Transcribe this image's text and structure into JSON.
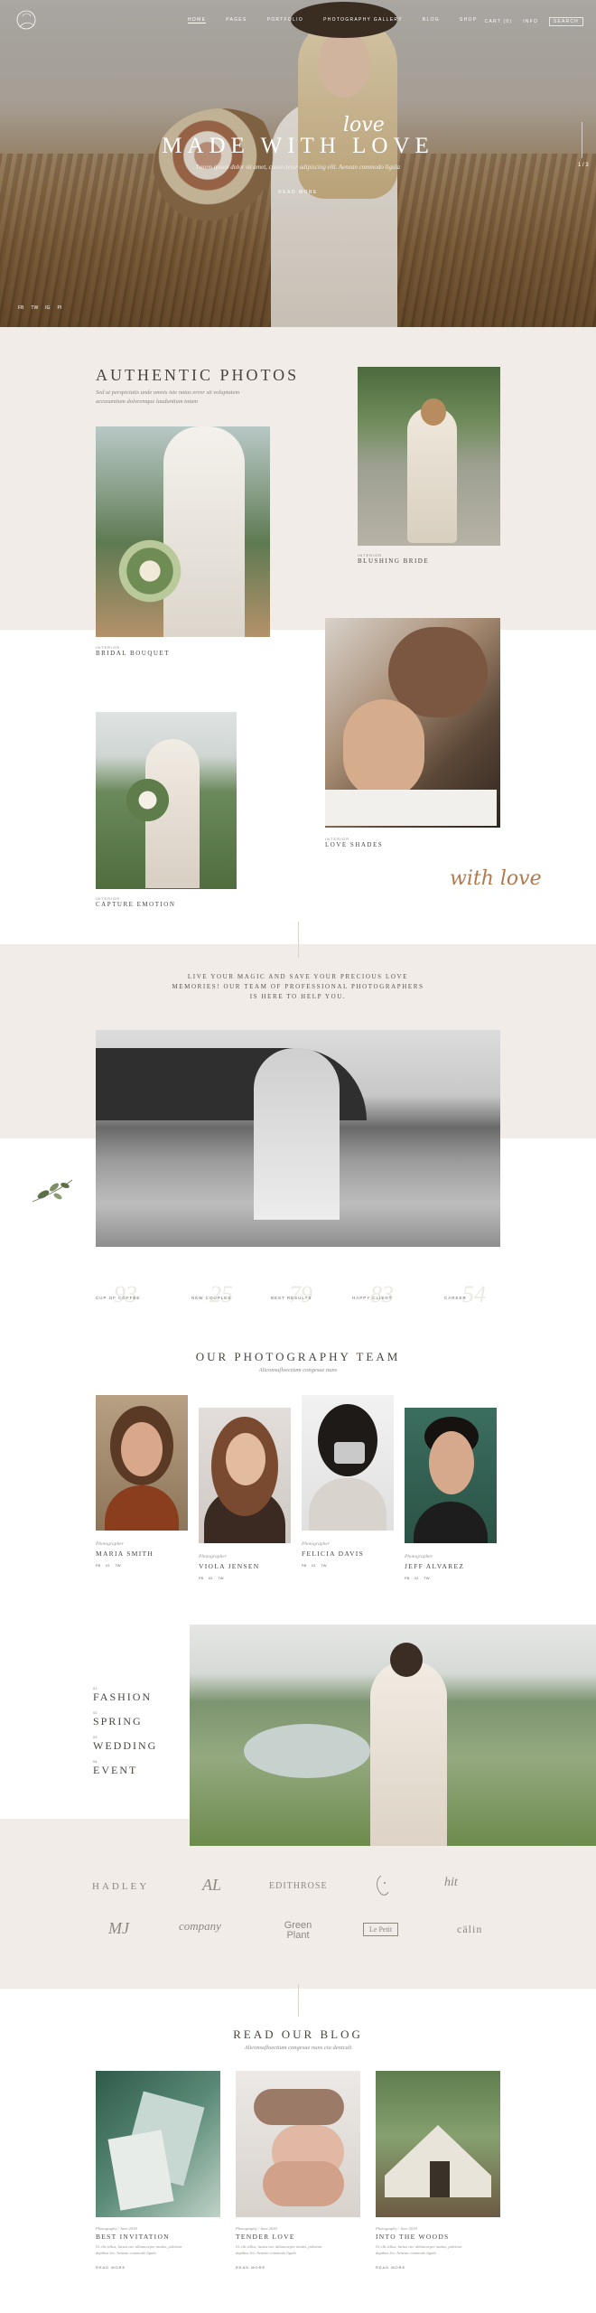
{
  "nav": {
    "items": [
      "HOME",
      "PAGES",
      "PORTFOLIO",
      "PHOTOGRAPHY GALLERY",
      "BLOG",
      "SHOP"
    ],
    "cart": "CART (0)",
    "info": "INFO",
    "search": "SEARCH"
  },
  "hero": {
    "title": "MADE WITH LOVE",
    "script": "love",
    "subtitle": "Lorem ipsum dolor sit amet, consectetur adipiscing elit. Aenean commodo ligula",
    "link": "READ MORE",
    "social": [
      "FB",
      "TW",
      "IG",
      "PI"
    ],
    "counter": "1 / 3"
  },
  "authentic": {
    "title": "AUTHENTIC PHOTOS",
    "subtitle_line1": "Sed ut perspiciatis unde omnis iste natus error sit voluptatem",
    "subtitle_line2": "accusantium doloremque laudantium totam",
    "items": [
      {
        "label": "INTERIOR",
        "title": "BRIDAL BOUQUET"
      },
      {
        "label": "INTERIOR",
        "title": "BLUSHING BRIDE"
      },
      {
        "label": "INTERIOR",
        "title": "LOVE SHADES"
      },
      {
        "label": "INTERIOR",
        "title": "CAPTURE EMOTION"
      }
    ],
    "script": "with love"
  },
  "quote": {
    "line1": "LIVE YOUR MAGIC AND SAVE YOUR PRECIOUS LOVE",
    "line2": "MEMORIES! OUR TEAM OF PROFESSIONAL PHOTOGRAPHERS",
    "line3": "IS HERE TO HELP YOU."
  },
  "stats": [
    {
      "label": "CUP OF COFFEE",
      "value": "93"
    },
    {
      "label": "NEW COUPLES",
      "value": "25"
    },
    {
      "label": "BEST RESULTS",
      "value": "79"
    },
    {
      "label": "HAPPY CLIENT",
      "value": "83"
    },
    {
      "label": "CAREER",
      "value": "54"
    }
  ],
  "team": {
    "title": "OUR PHOTOGRAPHY TEAM",
    "subtitle": "Aliconsufloectium congesue nuns",
    "members": [
      {
        "role": "Photographer",
        "name": "MARIA SMITH",
        "social": [
          "FB",
          "IG",
          "TW"
        ]
      },
      {
        "role": "Photographer",
        "name": "VIOLA JENSEN",
        "social": [
          "FB",
          "IG",
          "TW"
        ]
      },
      {
        "role": "Photographer",
        "name": "FELICIA DAVIS",
        "social": [
          "FB",
          "IG",
          "TW"
        ]
      },
      {
        "role": "Photographer",
        "name": "JEFF ALVAREZ",
        "social": [
          "FB",
          "IG",
          "TW"
        ]
      }
    ]
  },
  "categories": [
    {
      "num": "01",
      "label": "FASHION"
    },
    {
      "num": "02",
      "label": "SPRING"
    },
    {
      "num": "03",
      "label": "WEDDING"
    },
    {
      "num": "04",
      "label": "EVENT"
    }
  ],
  "brands": [
    "HADLEY",
    "AL",
    "EDITHROSE",
    "",
    "hit",
    "MJ",
    "company",
    "Green Plant",
    "Le Petit",
    "cälin"
  ],
  "blog": {
    "title": "READ OUR BLOG",
    "subtitle": "Aliconsufloectium congesue nuns cia denicali",
    "posts": [
      {
        "meta": "Photography / June 2018",
        "title": "BEST INVITATION",
        "excerpt_line1": "Ut elit tellus, luctus nec ullamcorper mattis, pulvinar",
        "excerpt_line2": "dapibus leo. Aenean commodo ligula",
        "more": "READ MORE"
      },
      {
        "meta": "Photography / June 2018",
        "title": "TENDER LOVE",
        "excerpt_line1": "Ut elit tellus, luctus nec ullamcorper mattis, pulvinar",
        "excerpt_line2": "dapibus leo. Aenean commodo ligula",
        "more": "READ MORE"
      },
      {
        "meta": "Photography / June 2018",
        "title": "INTO THE WOODS",
        "excerpt_line1": "Ut elit tellus, luctus nec ullamcorper mattis, pulvinar",
        "excerpt_line2": "dapibus leo. Aenean commodo ligula",
        "more": "READ MORE"
      }
    ]
  },
  "colors": {
    "beige": "#f1ece7",
    "accent": "#b07a4e",
    "text": "#4a4540"
  }
}
